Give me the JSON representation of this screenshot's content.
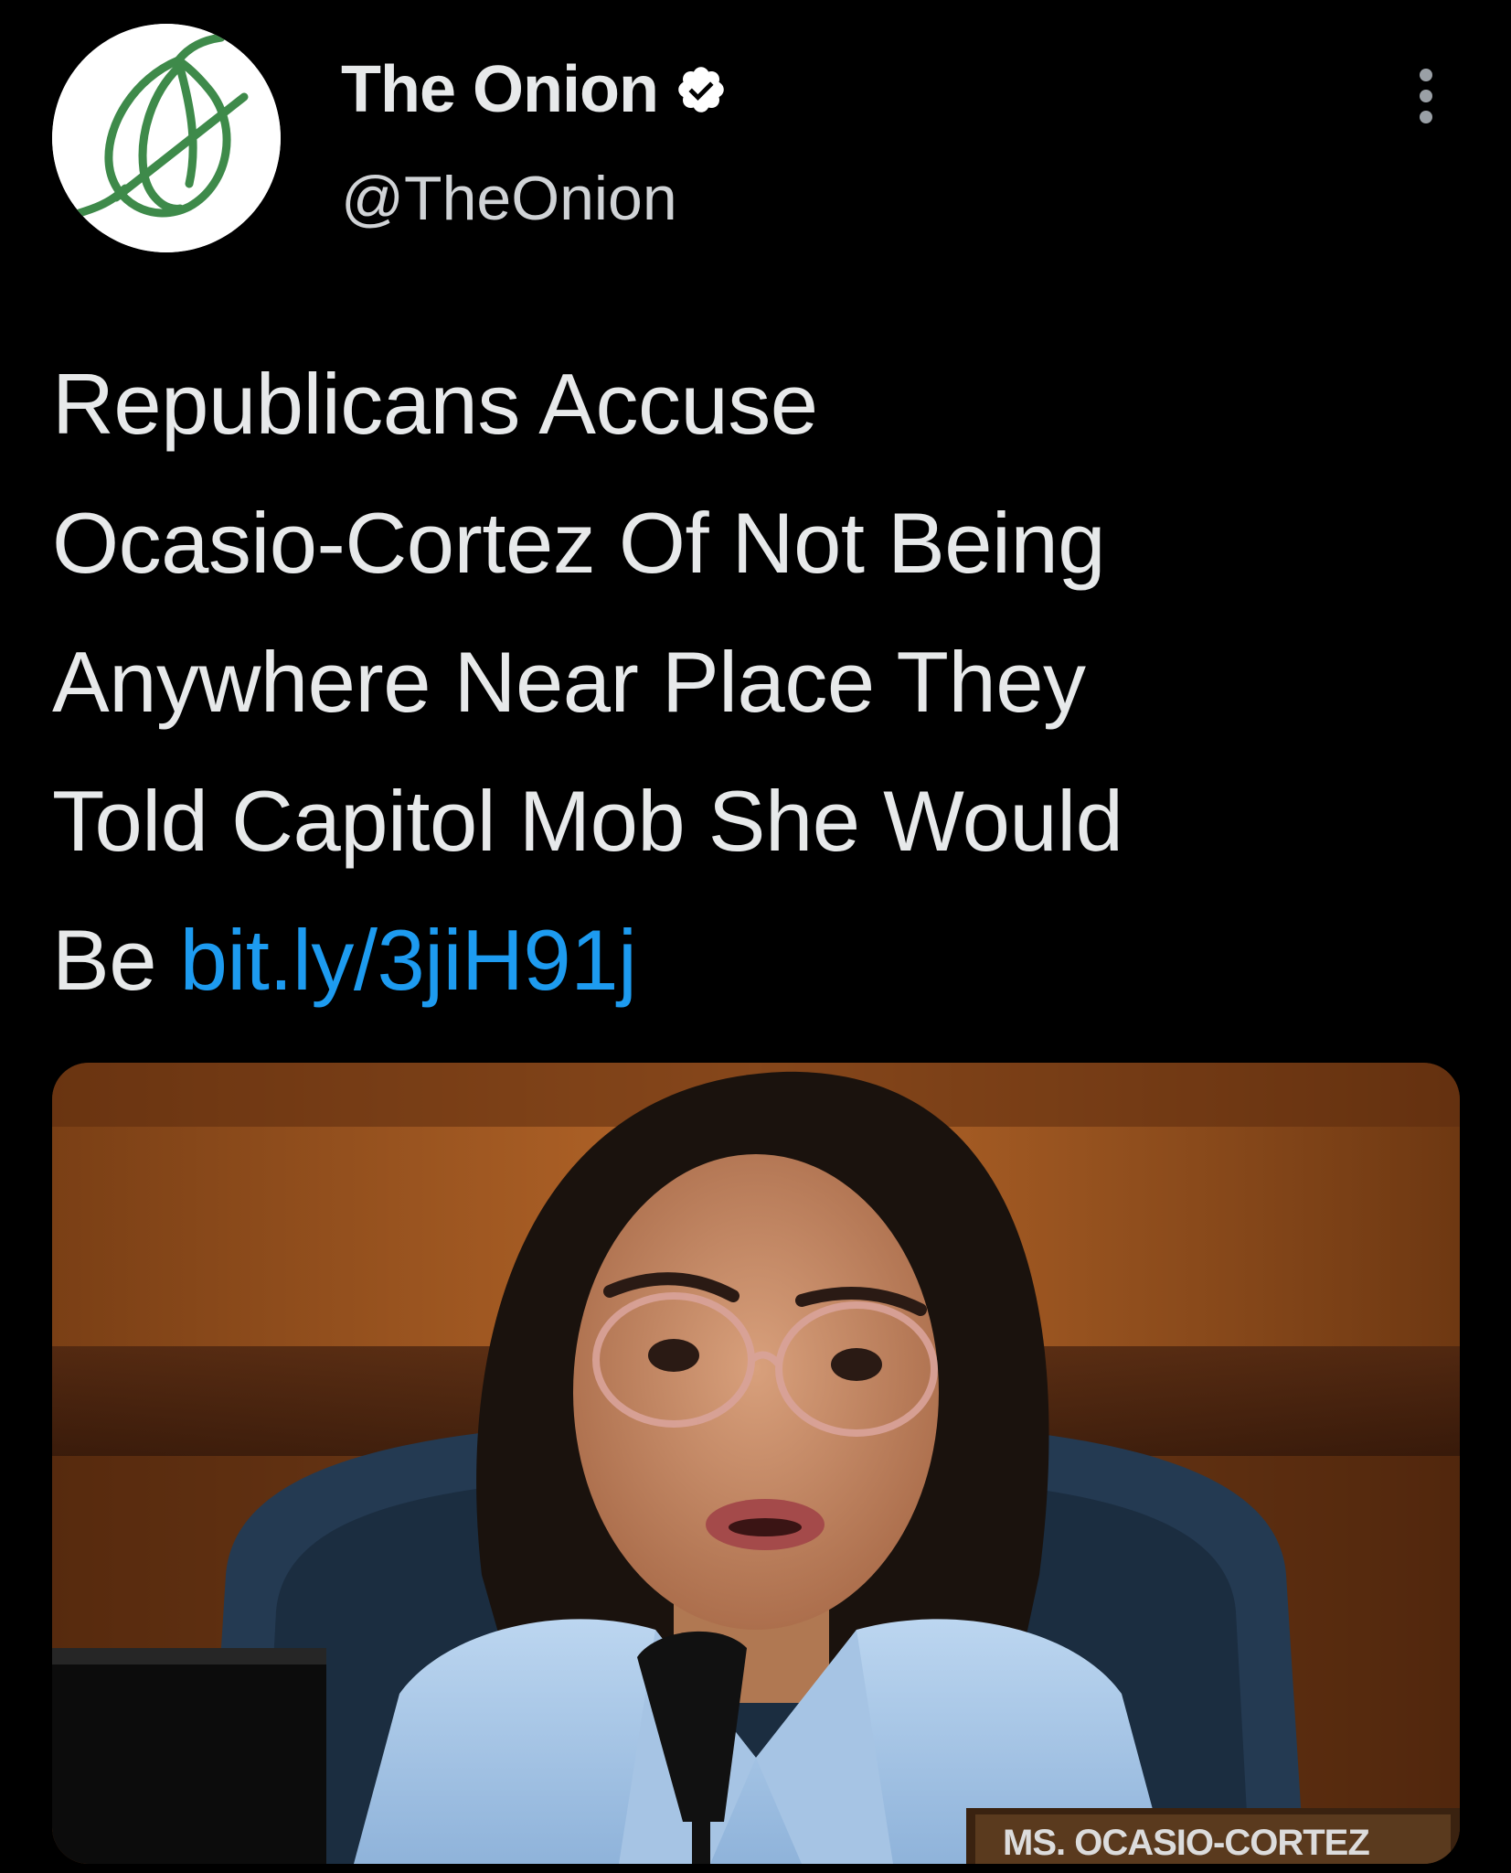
{
  "tweet": {
    "author": {
      "display_name": "The Onion",
      "handle": "@TheOnion",
      "verified": true,
      "avatar_icon": "onion-logo-icon",
      "brand_color": "#3e8a4a"
    },
    "text_lines": [
      "Republicans Accuse",
      "Ocasio-Cortez Of Not Being",
      "Anywhere Near Place They",
      "Told Capitol Mob She Would",
      "Be"
    ],
    "link": "bit.ly/3jiH91j",
    "link_color": "#1d9bf0",
    "media": {
      "nameplate_text": "MS. OCASIO-CORTEZ"
    }
  },
  "menu": {
    "icon": "more-vertical-icon"
  }
}
